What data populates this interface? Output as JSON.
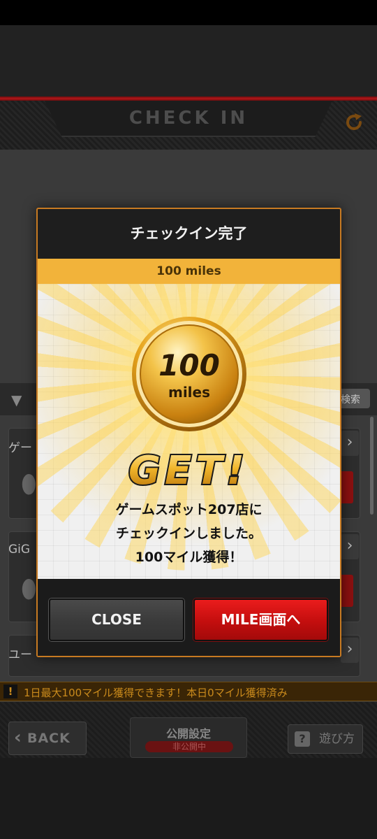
{
  "header": {
    "title": "CHECK IN"
  },
  "background": {
    "search_label": "検索",
    "cards": [
      {
        "label": "ゲー"
      },
      {
        "label": "GiG"
      },
      {
        "label": "ユー"
      }
    ]
  },
  "notice": {
    "icon": "!",
    "text": "1日最大100マイル獲得できます！本日0マイル獲得済み"
  },
  "footer": {
    "back_label": "BACK",
    "public_settings_title": "公開設定",
    "public_settings_status": "非公開中",
    "howto_label": "遊び方",
    "howto_icon": "?"
  },
  "modal": {
    "title": "チェックイン完了",
    "band": "100 miles",
    "coin_value": "100",
    "coin_unit": "miles",
    "get_text": "GET!",
    "message_lines": [
      "ゲームスポット207店に",
      "チェックインしました。",
      "100マイル獲得！"
    ],
    "close_label": "CLOSE",
    "mile_label": "MILE画面へ"
  },
  "colors": {
    "accent_orange": "#f2b33a",
    "modal_border": "#c77a22",
    "primary_red": "#c30e0e",
    "notice_text": "#c98a1c"
  }
}
